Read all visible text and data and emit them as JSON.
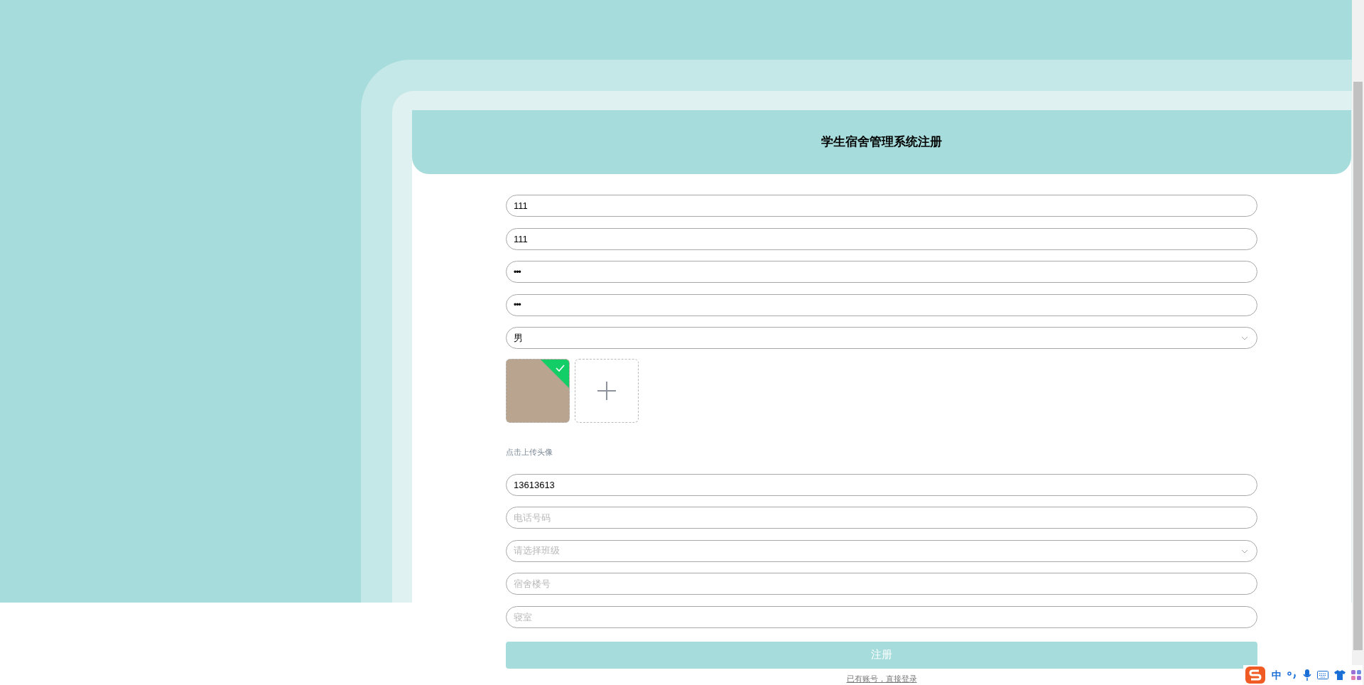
{
  "header": {
    "title": "学生宿舍管理系统注册"
  },
  "fields_top": [
    {
      "kind": "input",
      "value": "111"
    },
    {
      "kind": "input",
      "value": "111"
    },
    {
      "kind": "password",
      "value": "•••"
    },
    {
      "kind": "password",
      "value": "•••"
    },
    {
      "kind": "select",
      "value": "男"
    }
  ],
  "upload": {
    "photos": [
      {
        "uploaded": true
      }
    ],
    "tip": "点击上传头像"
  },
  "fields_bottom": [
    {
      "kind": "input",
      "value": "13613613"
    },
    {
      "kind": "input",
      "placeholder": "电话号码"
    },
    {
      "kind": "select",
      "placeholder": "请选择班级"
    },
    {
      "kind": "input",
      "placeholder": "宿舍楼号"
    },
    {
      "kind": "input",
      "placeholder": "寝室"
    }
  ],
  "submit": "注册",
  "login_link": "已有账号，直接登录",
  "ime": {
    "mode": "中"
  }
}
